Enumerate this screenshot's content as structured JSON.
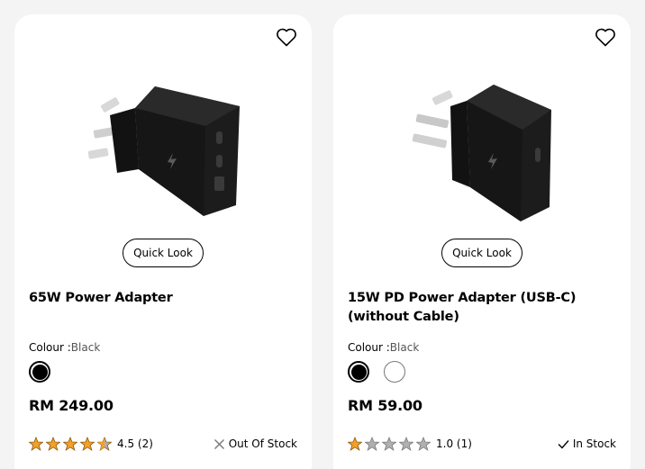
{
  "products": [
    {
      "name": "65W Power Adapter",
      "quick_look_label": "Quick Look",
      "colour_label": "Colour :",
      "colour_value": "Black",
      "swatches": [
        {
          "color": "#000000",
          "selected": true
        }
      ],
      "price": "RM 249.00",
      "rating_value": 4.5,
      "rating_text": "4.5 (2)",
      "stock_text": "Out Of Stock",
      "stock_icon": "close-icon",
      "wishlist_icon": "heart-icon"
    },
    {
      "name": "15W PD Power Adapter (USB-C) (without Cable)",
      "quick_look_label": "Quick Look",
      "colour_label": "Colour :",
      "colour_value": "Black",
      "swatches": [
        {
          "color": "#000000",
          "selected": true
        },
        {
          "color": "#ffffff",
          "selected": false
        }
      ],
      "price": "RM 59.00",
      "rating_value": 1.0,
      "rating_text": "1.0 (1)",
      "stock_text": "In Stock",
      "stock_icon": "check-icon",
      "wishlist_icon": "heart-icon"
    }
  ],
  "colors": {
    "star_filled": "#f4a028",
    "star_empty": "#9a9a9a",
    "star_outline": "#8a5a10"
  }
}
